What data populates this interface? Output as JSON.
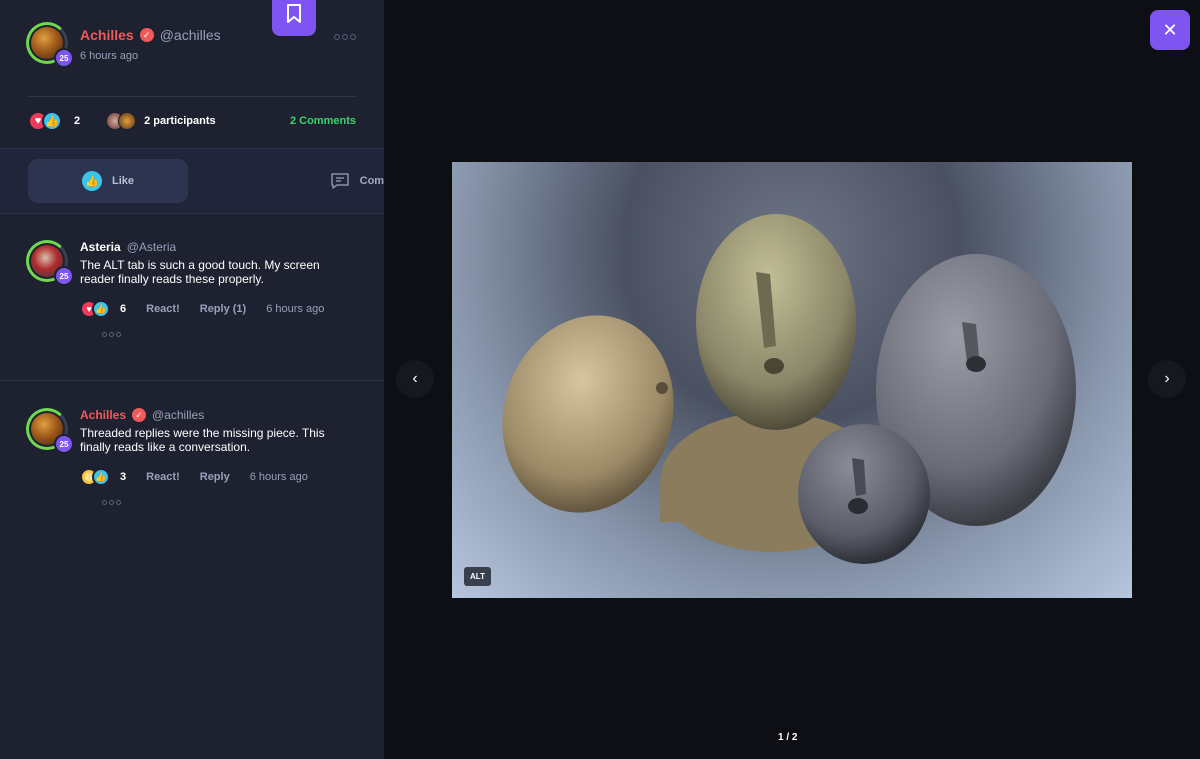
{
  "post": {
    "author_name": "Achilles",
    "author_handle": "@achilles",
    "author_level": "25",
    "time": "6 hours ago",
    "reaction_count": "2",
    "participants": "2 participants",
    "comments": "2 Comments"
  },
  "actions": {
    "like_label": "Like",
    "comment_label": "Comment"
  },
  "comments": [
    {
      "name": "Asteria",
      "handle": "@Asteria",
      "level": "25",
      "body": "The ALT tab is such a good touch. My screen reader finally reads these properly.",
      "reaction_count": "6",
      "react_label": "React!",
      "reply_label": "Reply (1)",
      "time": "6 hours ago"
    },
    {
      "name": "Achilles",
      "handle": "@achilles",
      "level": "25",
      "body": "Threaded replies were the missing piece. This finally reads like a conversation.",
      "reaction_count": "3",
      "react_label": "React!",
      "reply_label": "Reply",
      "time": "6 hours ago"
    }
  ],
  "viewer": {
    "alt_label": "ALT",
    "counter": "1 / 2"
  },
  "colors": {
    "accent": "#7e55f0",
    "name_red": "#f05a5a",
    "comments_green": "#3cd46a",
    "panel_bg": "#1d2130",
    "viewer_bg": "#0e0f14"
  },
  "icons": [
    "bookmark-icon",
    "verified-icon",
    "more-icon",
    "heart-icon",
    "thumbs-up-icon",
    "laugh-icon",
    "comment-icon",
    "close-icon",
    "chevron-left-icon",
    "chevron-right-icon"
  ]
}
